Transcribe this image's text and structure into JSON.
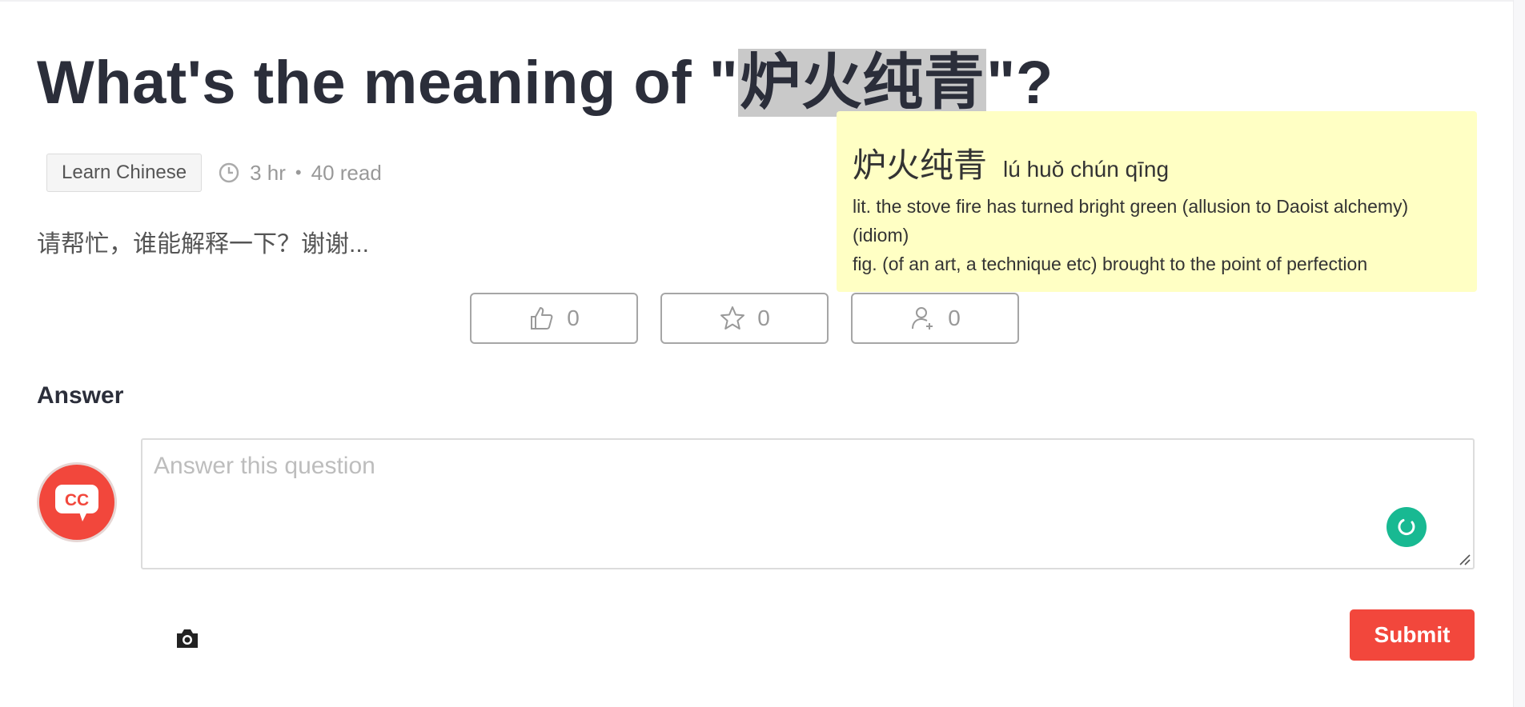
{
  "question": {
    "title_prefix": "What's the meaning of \"",
    "title_highlight": "炉火纯青",
    "title_suffix": "\"?",
    "tag": "Learn Chinese",
    "time": "3 hr",
    "separator": "•",
    "reads": "40 read",
    "description": "请帮忙，谁能解释一下？谢谢..."
  },
  "actions": {
    "like_count": "0",
    "favorite_count": "0",
    "follow_count": "0"
  },
  "answer": {
    "heading": "Answer",
    "avatar_text": "CC",
    "placeholder": "Answer this question",
    "submit_label": "Submit"
  },
  "dictionary_popup": {
    "hanzi": "炉火纯青",
    "pinyin": "lú huǒ chún qīng",
    "definitions": [
      "lit. the stove fire has turned bright green (allusion to Daoist alchemy)",
      "(idiom)",
      "fig. (of an art, a technique etc) brought to the point of perfection"
    ]
  },
  "colors": {
    "brand_red": "#f2473c",
    "popup_bg": "#ffffc4",
    "grammar_green": "#18b992"
  }
}
